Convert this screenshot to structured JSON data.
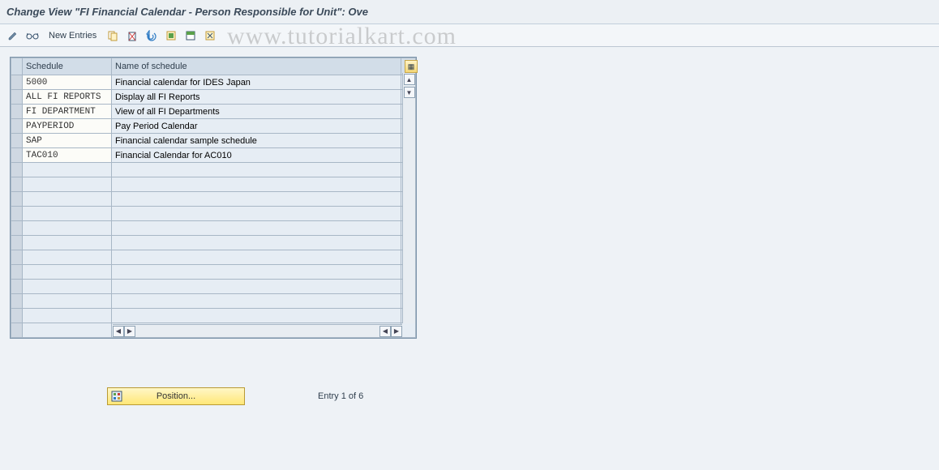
{
  "title": "Change View \"FI Financial Calendar - Person Responsible for Unit\": Ove",
  "watermark": "www.tutorialkart.com",
  "toolbar": {
    "new_entries_label": "New Entries"
  },
  "table": {
    "headers": {
      "schedule": "Schedule",
      "name": "Name of schedule"
    },
    "rows": [
      {
        "key": "5000",
        "name": "Financial calendar for IDES Japan"
      },
      {
        "key": "ALL FI REPORTS",
        "name": "Display all FI Reports"
      },
      {
        "key": "FI DEPARTMENT",
        "name": "View of all FI Departments"
      },
      {
        "key": "PAYPERIOD",
        "name": "Pay Period Calendar"
      },
      {
        "key": "SAP",
        "name": "Financial calendar sample schedule"
      },
      {
        "key": "TAC010",
        "name": "Financial Calendar for AC010"
      }
    ],
    "empty_rows": 12
  },
  "footer": {
    "position_label": "Position...",
    "entry_text": "Entry 1 of 6"
  }
}
